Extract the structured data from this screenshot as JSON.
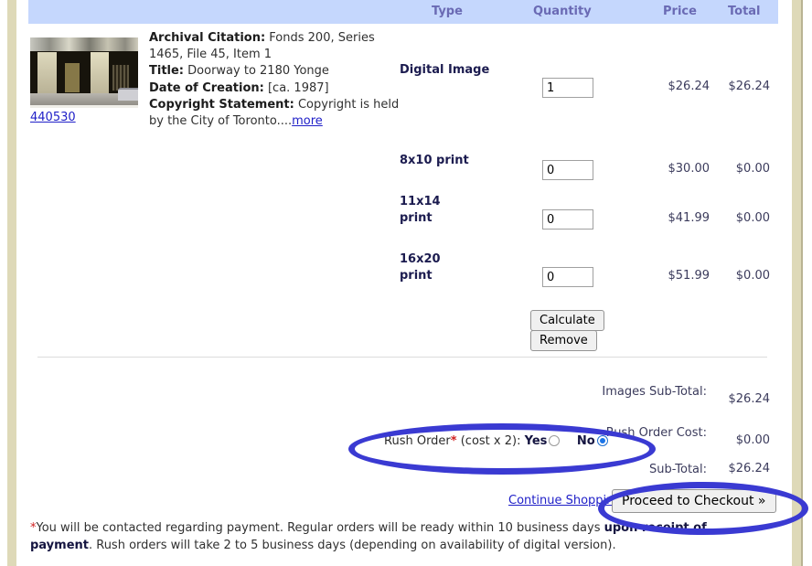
{
  "table": {
    "headers": {
      "type": "Type",
      "quantity": "Quantity",
      "price": "Price",
      "total": "Total"
    }
  },
  "item": {
    "thumbnail_id": "440530",
    "thumbnail_alt": "Doorway to 2180 Yonge",
    "labels": {
      "archival_citation": "Archival Citation:",
      "title": "Title:",
      "date_of_creation": "Date of Creation:",
      "copyright_statement": "Copyright Statement:"
    },
    "archival_citation": "Fonds 200, Series 1465, File 45, Item 1",
    "title": "Doorway to 2180 Yonge",
    "date_of_creation": "[ca. 1987]",
    "copyright_statement": "Copyright is held by the City of Toronto....",
    "more_link": "more",
    "options": [
      {
        "type": "Digital Image",
        "quantity": "1",
        "price": "$26.24",
        "total": "$26.24"
      },
      {
        "type": "8x10 print",
        "quantity": "0",
        "price": "$30.00",
        "total": "$0.00"
      },
      {
        "type": "11x14 print",
        "quantity": "0",
        "price": "$41.99",
        "total": "$0.00"
      },
      {
        "type": "16x20 print",
        "quantity": "0",
        "price": "$51.99",
        "total": "$0.00"
      }
    ],
    "calculate_label": "Calculate",
    "remove_label": "Remove"
  },
  "totals": [
    {
      "label": "Images Sub-Total:",
      "value": "$26.24"
    },
    {
      "label": "Rush Order Cost:",
      "value": "$0.00"
    },
    {
      "label": "Sub-Total:",
      "value": "$26.24"
    }
  ],
  "rush_order": {
    "label": "Rush Order",
    "asterisk": "*",
    "note": " (cost x 2): ",
    "yes_label": "Yes",
    "no_label": "No",
    "selected": "No"
  },
  "footer": {
    "continue_shopping": "Continue Shopping",
    "checkout_label": "Proceed to Checkout »",
    "footnote_star": "*",
    "footnote_part1": "You will be contacted regarding payment. Regular orders will be ready within 10 business days ",
    "footnote_bold": "upon receipt of payment",
    "footnote_part2": ". Rush orders will take 2 to 5 business days (depending on availability of digital version)."
  },
  "colors": {
    "header_band": "#c5d7fd",
    "header_text": "#6a6ab4",
    "frame": "#ded9b8",
    "link": "#2020c8",
    "annotation": "#3a3ad2",
    "required": "#d02020"
  }
}
